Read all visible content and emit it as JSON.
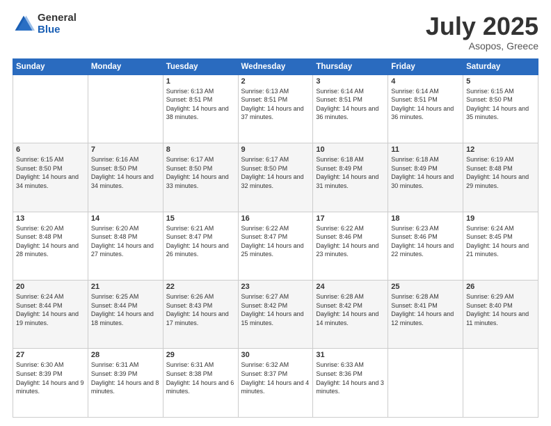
{
  "header": {
    "logo_general": "General",
    "logo_blue": "Blue",
    "title": "July 2025",
    "subtitle": "Asopos, Greece"
  },
  "days_of_week": [
    "Sunday",
    "Monday",
    "Tuesday",
    "Wednesday",
    "Thursday",
    "Friday",
    "Saturday"
  ],
  "weeks": [
    [
      {
        "day": "",
        "sunrise": "",
        "sunset": "",
        "daylight": ""
      },
      {
        "day": "",
        "sunrise": "",
        "sunset": "",
        "daylight": ""
      },
      {
        "day": "1",
        "sunrise": "Sunrise: 6:13 AM",
        "sunset": "Sunset: 8:51 PM",
        "daylight": "Daylight: 14 hours and 38 minutes."
      },
      {
        "day": "2",
        "sunrise": "Sunrise: 6:13 AM",
        "sunset": "Sunset: 8:51 PM",
        "daylight": "Daylight: 14 hours and 37 minutes."
      },
      {
        "day": "3",
        "sunrise": "Sunrise: 6:14 AM",
        "sunset": "Sunset: 8:51 PM",
        "daylight": "Daylight: 14 hours and 36 minutes."
      },
      {
        "day": "4",
        "sunrise": "Sunrise: 6:14 AM",
        "sunset": "Sunset: 8:51 PM",
        "daylight": "Daylight: 14 hours and 36 minutes."
      },
      {
        "day": "5",
        "sunrise": "Sunrise: 6:15 AM",
        "sunset": "Sunset: 8:50 PM",
        "daylight": "Daylight: 14 hours and 35 minutes."
      }
    ],
    [
      {
        "day": "6",
        "sunrise": "Sunrise: 6:15 AM",
        "sunset": "Sunset: 8:50 PM",
        "daylight": "Daylight: 14 hours and 34 minutes."
      },
      {
        "day": "7",
        "sunrise": "Sunrise: 6:16 AM",
        "sunset": "Sunset: 8:50 PM",
        "daylight": "Daylight: 14 hours and 34 minutes."
      },
      {
        "day": "8",
        "sunrise": "Sunrise: 6:17 AM",
        "sunset": "Sunset: 8:50 PM",
        "daylight": "Daylight: 14 hours and 33 minutes."
      },
      {
        "day": "9",
        "sunrise": "Sunrise: 6:17 AM",
        "sunset": "Sunset: 8:50 PM",
        "daylight": "Daylight: 14 hours and 32 minutes."
      },
      {
        "day": "10",
        "sunrise": "Sunrise: 6:18 AM",
        "sunset": "Sunset: 8:49 PM",
        "daylight": "Daylight: 14 hours and 31 minutes."
      },
      {
        "day": "11",
        "sunrise": "Sunrise: 6:18 AM",
        "sunset": "Sunset: 8:49 PM",
        "daylight": "Daylight: 14 hours and 30 minutes."
      },
      {
        "day": "12",
        "sunrise": "Sunrise: 6:19 AM",
        "sunset": "Sunset: 8:48 PM",
        "daylight": "Daylight: 14 hours and 29 minutes."
      }
    ],
    [
      {
        "day": "13",
        "sunrise": "Sunrise: 6:20 AM",
        "sunset": "Sunset: 8:48 PM",
        "daylight": "Daylight: 14 hours and 28 minutes."
      },
      {
        "day": "14",
        "sunrise": "Sunrise: 6:20 AM",
        "sunset": "Sunset: 8:48 PM",
        "daylight": "Daylight: 14 hours and 27 minutes."
      },
      {
        "day": "15",
        "sunrise": "Sunrise: 6:21 AM",
        "sunset": "Sunset: 8:47 PM",
        "daylight": "Daylight: 14 hours and 26 minutes."
      },
      {
        "day": "16",
        "sunrise": "Sunrise: 6:22 AM",
        "sunset": "Sunset: 8:47 PM",
        "daylight": "Daylight: 14 hours and 25 minutes."
      },
      {
        "day": "17",
        "sunrise": "Sunrise: 6:22 AM",
        "sunset": "Sunset: 8:46 PM",
        "daylight": "Daylight: 14 hours and 23 minutes."
      },
      {
        "day": "18",
        "sunrise": "Sunrise: 6:23 AM",
        "sunset": "Sunset: 8:46 PM",
        "daylight": "Daylight: 14 hours and 22 minutes."
      },
      {
        "day": "19",
        "sunrise": "Sunrise: 6:24 AM",
        "sunset": "Sunset: 8:45 PM",
        "daylight": "Daylight: 14 hours and 21 minutes."
      }
    ],
    [
      {
        "day": "20",
        "sunrise": "Sunrise: 6:24 AM",
        "sunset": "Sunset: 8:44 PM",
        "daylight": "Daylight: 14 hours and 19 minutes."
      },
      {
        "day": "21",
        "sunrise": "Sunrise: 6:25 AM",
        "sunset": "Sunset: 8:44 PM",
        "daylight": "Daylight: 14 hours and 18 minutes."
      },
      {
        "day": "22",
        "sunrise": "Sunrise: 6:26 AM",
        "sunset": "Sunset: 8:43 PM",
        "daylight": "Daylight: 14 hours and 17 minutes."
      },
      {
        "day": "23",
        "sunrise": "Sunrise: 6:27 AM",
        "sunset": "Sunset: 8:42 PM",
        "daylight": "Daylight: 14 hours and 15 minutes."
      },
      {
        "day": "24",
        "sunrise": "Sunrise: 6:28 AM",
        "sunset": "Sunset: 8:42 PM",
        "daylight": "Daylight: 14 hours and 14 minutes."
      },
      {
        "day": "25",
        "sunrise": "Sunrise: 6:28 AM",
        "sunset": "Sunset: 8:41 PM",
        "daylight": "Daylight: 14 hours and 12 minutes."
      },
      {
        "day": "26",
        "sunrise": "Sunrise: 6:29 AM",
        "sunset": "Sunset: 8:40 PM",
        "daylight": "Daylight: 14 hours and 11 minutes."
      }
    ],
    [
      {
        "day": "27",
        "sunrise": "Sunrise: 6:30 AM",
        "sunset": "Sunset: 8:39 PM",
        "daylight": "Daylight: 14 hours and 9 minutes."
      },
      {
        "day": "28",
        "sunrise": "Sunrise: 6:31 AM",
        "sunset": "Sunset: 8:39 PM",
        "daylight": "Daylight: 14 hours and 8 minutes."
      },
      {
        "day": "29",
        "sunrise": "Sunrise: 6:31 AM",
        "sunset": "Sunset: 8:38 PM",
        "daylight": "Daylight: 14 hours and 6 minutes."
      },
      {
        "day": "30",
        "sunrise": "Sunrise: 6:32 AM",
        "sunset": "Sunset: 8:37 PM",
        "daylight": "Daylight: 14 hours and 4 minutes."
      },
      {
        "day": "31",
        "sunrise": "Sunrise: 6:33 AM",
        "sunset": "Sunset: 8:36 PM",
        "daylight": "Daylight: 14 hours and 3 minutes."
      },
      {
        "day": "",
        "sunrise": "",
        "sunset": "",
        "daylight": ""
      },
      {
        "day": "",
        "sunrise": "",
        "sunset": "",
        "daylight": ""
      }
    ]
  ]
}
